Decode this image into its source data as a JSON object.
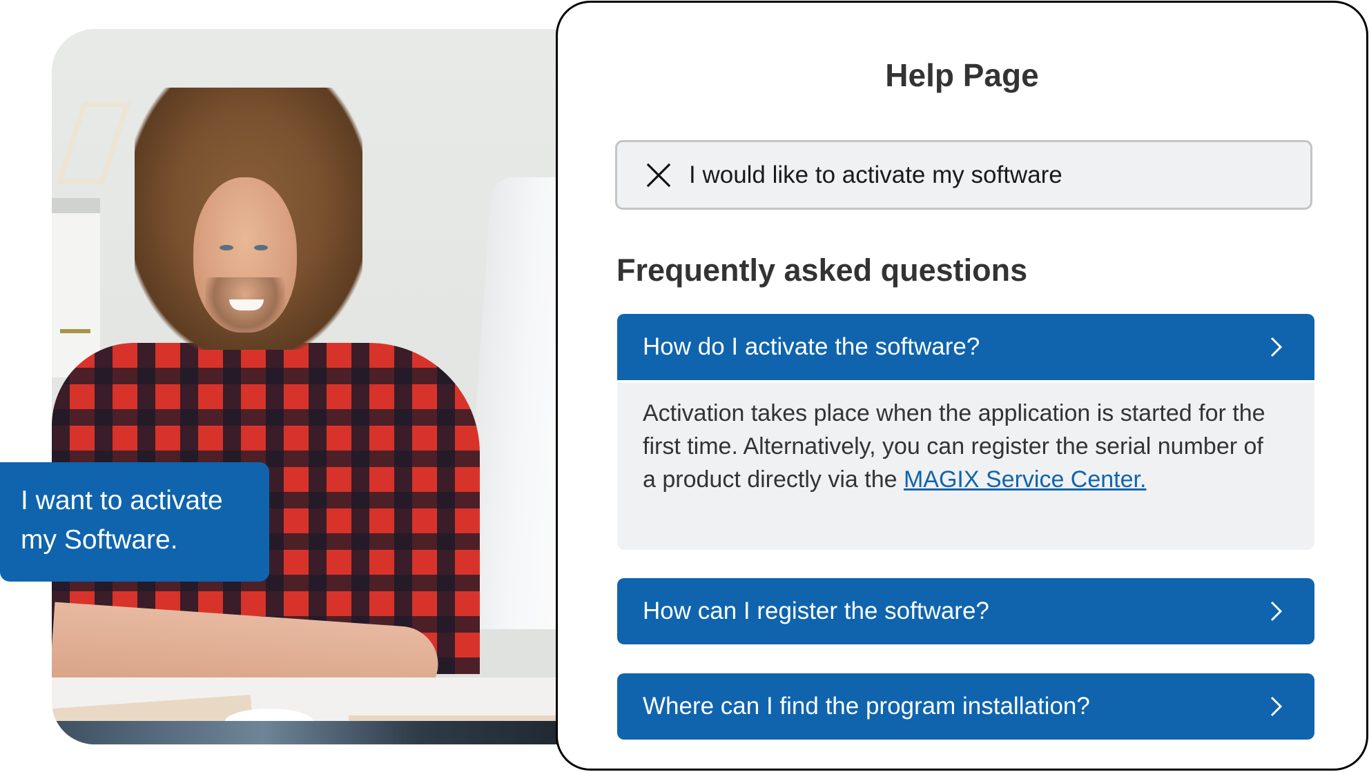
{
  "speech_bubble": {
    "text_line1": "I want to activate",
    "text_line2": "my Software."
  },
  "help_panel": {
    "title": "Help Page",
    "search": {
      "value": "I would like to activate my software",
      "clear_icon": "close-icon"
    },
    "faq_heading": "Frequently asked questions",
    "faqs": [
      {
        "question": "How do I activate the software?",
        "expanded": true,
        "answer_text": "Activation takes place when the application is started for the first time. Alternatively, you can register the serial number of a product directly via the ",
        "answer_link": "MAGIX Service Center.",
        "icon": "chevron-right-icon"
      },
      {
        "question": "How can I register the software?",
        "expanded": false,
        "icon": "chevron-right-icon"
      },
      {
        "question": "Where can I find the program installation?",
        "expanded": false,
        "icon": "chevron-right-icon"
      }
    ]
  },
  "colors": {
    "brand_blue": "#0f64ad",
    "panel_bg": "#f0f1f3",
    "text_dark": "#333333"
  }
}
